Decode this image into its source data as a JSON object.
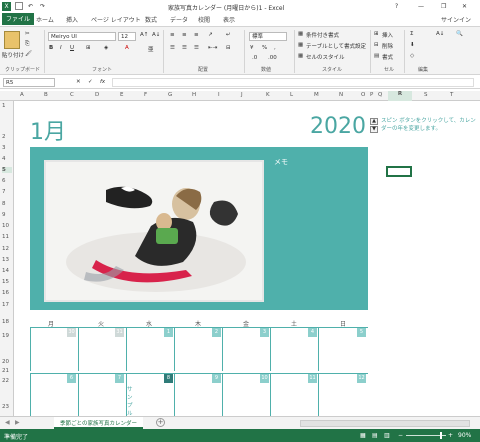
{
  "window": {
    "title": "家族写真カレンダー (月曜日から)1 - Excel",
    "user": "サインイン",
    "help": "?",
    "minimize": "—",
    "restore": "❐",
    "close": "✕"
  },
  "tabs": [
    {
      "label": "ファイル"
    },
    {
      "label": "ホーム"
    },
    {
      "label": "挿入"
    },
    {
      "label": "ページ レイアウト"
    },
    {
      "label": "数式"
    },
    {
      "label": "データ"
    },
    {
      "label": "校閲"
    },
    {
      "label": "表示"
    }
  ],
  "ribbon": {
    "paste_label": "貼り付け",
    "clipboard_group": "クリップボード",
    "font_name": "Meiryo UI",
    "font_size": "12",
    "font_group": "フォント",
    "align_group": "配置",
    "number_format": "標準",
    "number_group": "数値",
    "cond_format": "条件付き書式",
    "table_format": "テーブルとして書式設定",
    "cell_style": "セルのスタイル",
    "style_group": "スタイル",
    "insert": "挿入",
    "delete": "削除",
    "format": "書式",
    "cells_group": "セル",
    "edit_group": "編集"
  },
  "formula_bar": {
    "name_box": "R5",
    "fx": "fx",
    "cancel": "✕",
    "enter": "✓"
  },
  "columns": [
    "A",
    "B",
    "C",
    "D",
    "E",
    "F",
    "G",
    "H",
    "I",
    "J",
    "K",
    "L",
    "M",
    "N",
    "O",
    "P",
    "Q",
    "R",
    "S",
    "T"
  ],
  "rows": [
    "1",
    "2",
    "3",
    "4",
    "5",
    "6",
    "7",
    "8",
    "9",
    "10",
    "11",
    "12",
    "13",
    "14",
    "15",
    "16",
    "17",
    "18",
    "19",
    "20",
    "21",
    "22",
    "23"
  ],
  "calendar": {
    "month": "1月",
    "year": "2020",
    "memo": "メモ",
    "spin_hint": "スピン ボタンをクリックして、カレンダーの年を変更します。",
    "days": [
      "月",
      "火",
      "水",
      "木",
      "金",
      "土",
      "日"
    ],
    "week1": [
      "30",
      "31",
      "1",
      "2",
      "3",
      "4",
      "5"
    ],
    "week2": [
      "6",
      "7",
      "8",
      "9",
      "10",
      "11",
      "12"
    ],
    "sample_plan": "サンプルの予定"
  },
  "sheet": {
    "tab": "季節ごとの家族写真カレンダー",
    "add": "+"
  },
  "status": {
    "ready": "準備完了",
    "zoom": "90%"
  },
  "colors": {
    "accent": "#217346",
    "teal": "#4fb0ab"
  }
}
